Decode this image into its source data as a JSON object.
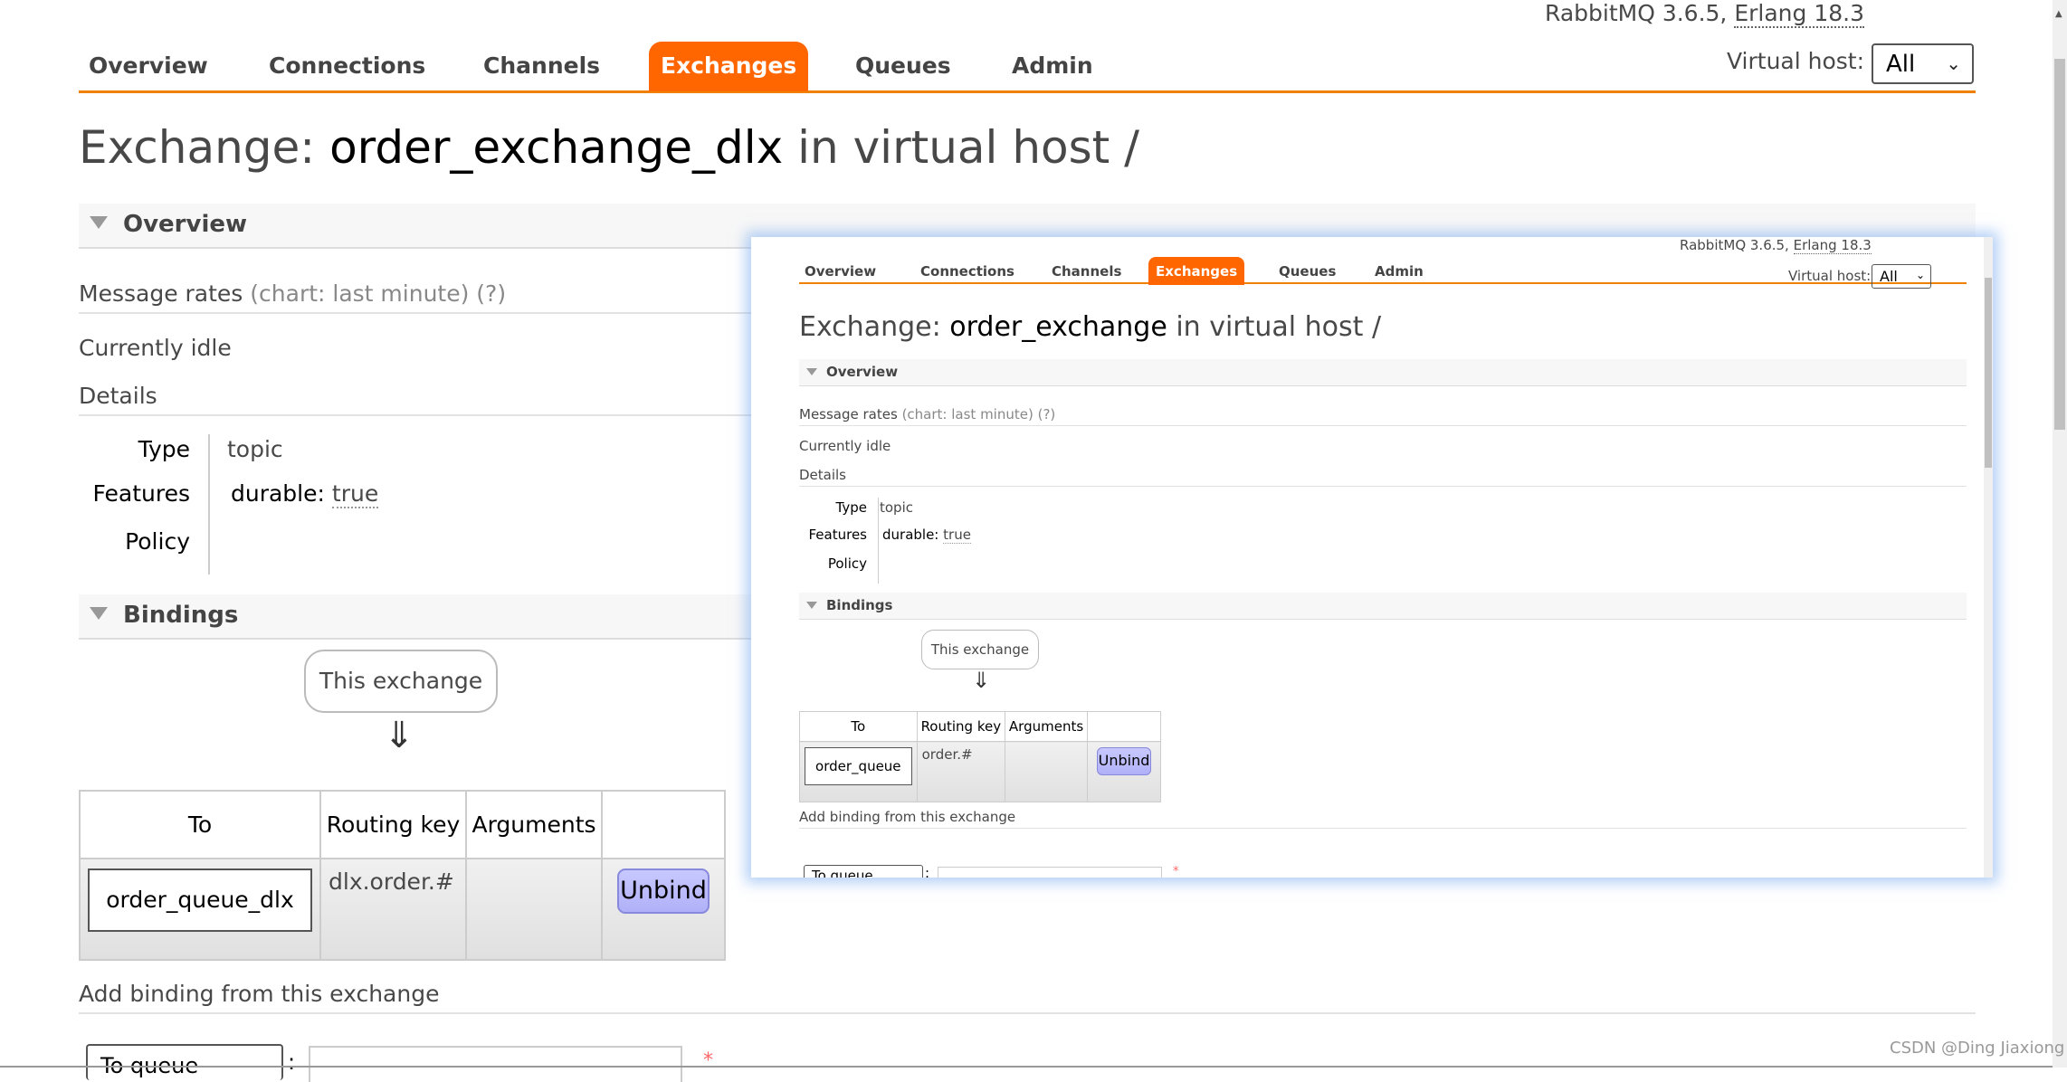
{
  "header": {
    "version_prefix": "RabbitMQ 3.6.5, ",
    "version_erlang": "Erlang 18.3",
    "tabs": [
      {
        "label": "Overview",
        "active": false
      },
      {
        "label": "Connections",
        "active": false
      },
      {
        "label": "Channels",
        "active": false
      },
      {
        "label": "Exchanges",
        "active": true
      },
      {
        "label": "Queues",
        "active": false
      },
      {
        "label": "Admin",
        "active": false
      }
    ],
    "vhost_label": "Virtual host:",
    "vhost_value": "All"
  },
  "page": {
    "title_prefix": "Exchange: ",
    "exchange_name": "order_exchange_dlx",
    "title_suffix": " in virtual host /",
    "overview_section": "Overview",
    "message_rates": "Message rates",
    "message_rates_note": "(chart: last minute) (?)",
    "currently_idle": "Currently idle",
    "details": "Details",
    "facts": {
      "type_label": "Type",
      "type_value": "topic",
      "features_label": "Features",
      "features_key": "durable: ",
      "features_value": "true",
      "policy_label": "Policy",
      "policy_value": ""
    },
    "bindings_section": "Bindings",
    "this_exchange": "This exchange",
    "arrow": "⇓",
    "bindings_table": {
      "headers": [
        "To",
        "Routing key",
        "Arguments",
        ""
      ],
      "rows": [
        {
          "to": "order_queue_dlx",
          "routing_key": "dlx.order.#",
          "arguments": "",
          "action": "Unbind"
        }
      ]
    },
    "add_binding": "Add binding from this exchange",
    "add_binding_select": "To queue",
    "add_binding_colon": ":",
    "add_binding_input": "",
    "required_mark": "*"
  },
  "popup": {
    "version_prefix": "RabbitMQ 3.6.5, ",
    "version_erlang": "Erlang 18.3",
    "tabs": [
      "Overview",
      "Connections",
      "Channels",
      "Exchanges",
      "Queues",
      "Admin"
    ],
    "active_tab": "Exchanges",
    "vhost_label": "Virtual host:",
    "vhost_value": "All",
    "title_prefix": "Exchange: ",
    "exchange_name": "order_exchange",
    "title_suffix": " in virtual host /",
    "overview_section": "Overview",
    "message_rates": "Message rates",
    "message_rates_note": "(chart: last minute) (?)",
    "currently_idle": "Currently idle",
    "details": "Details",
    "type_label": "Type",
    "type_value": "topic",
    "features_label": "Features",
    "features_key": "durable: ",
    "features_value": "true",
    "policy_label": "Policy",
    "bindings_section": "Bindings",
    "this_exchange": "This exchange",
    "arrow": "⇓",
    "table_headers": [
      "To",
      "Routing key",
      "Arguments",
      ""
    ],
    "row": {
      "to": "order_queue",
      "routing_key": "order.#",
      "arguments": "",
      "action": "Unbind"
    },
    "add_binding": "Add binding from this exchange",
    "add_binding_select": "To queue",
    "required_mark": "*"
  },
  "watermark": "CSDN @Ding Jiaxiong",
  "colors": {
    "accent": "#ff6600",
    "nav_line": "#f08000",
    "unbind_bg": "#c0c0ff",
    "required": "#ff6666"
  }
}
